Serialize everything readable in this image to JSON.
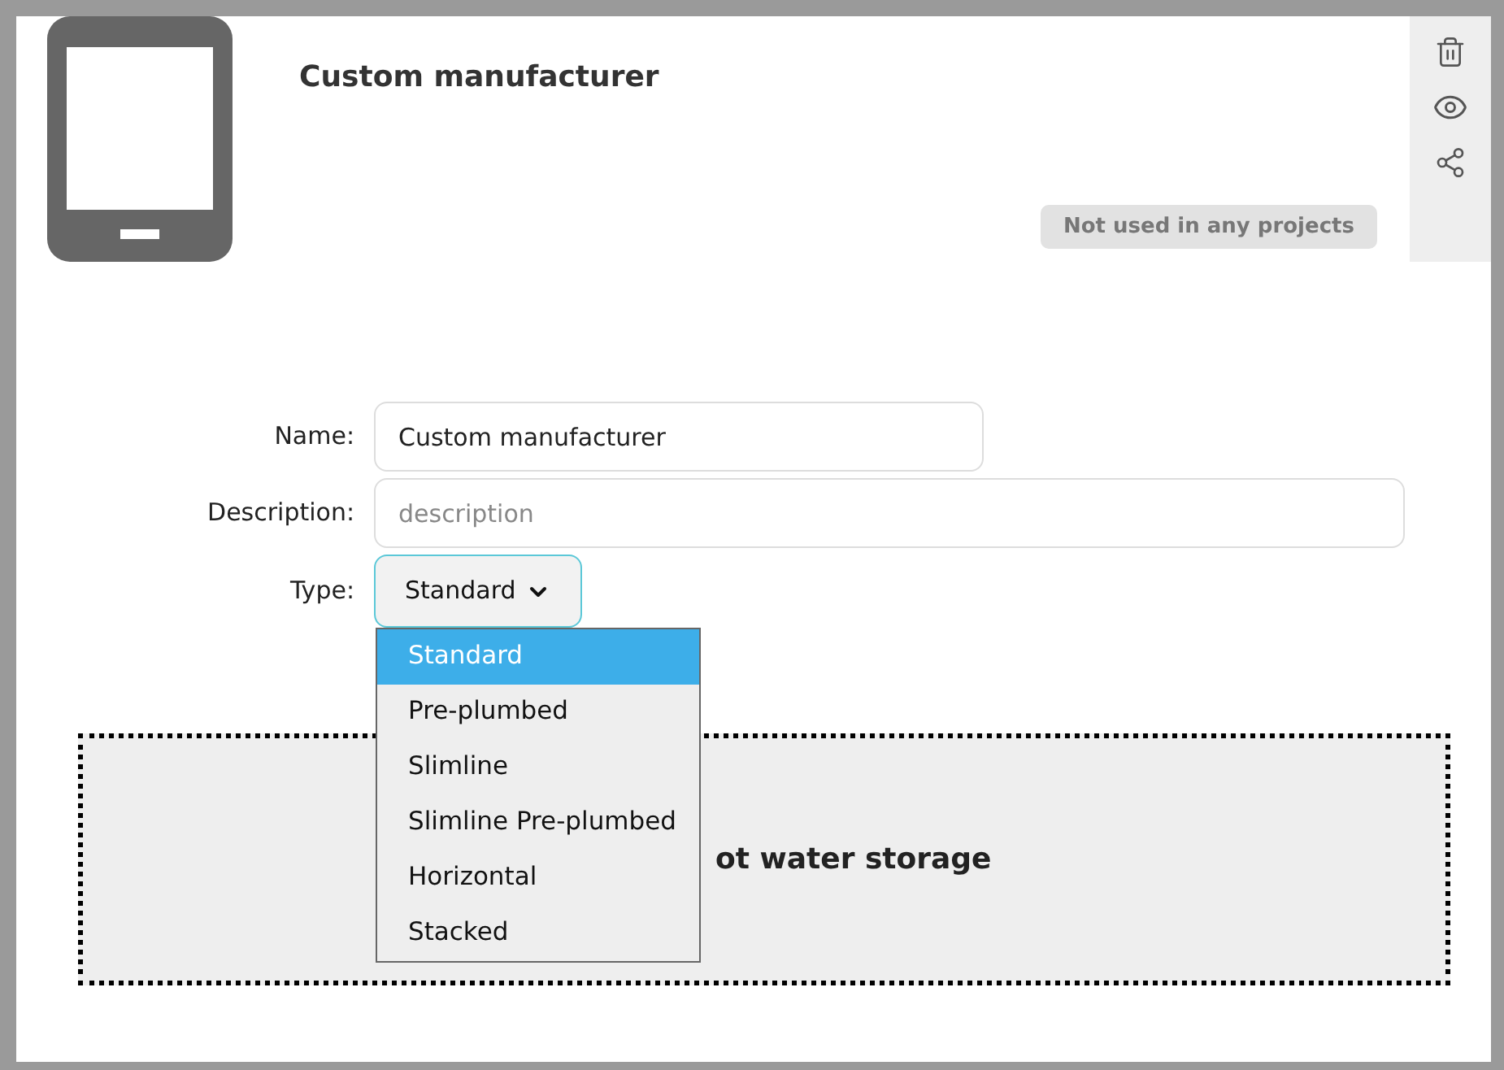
{
  "header": {
    "title": "Custom manufacturer",
    "usage_badge": "Not used in any projects"
  },
  "form": {
    "fields": [
      {
        "kind": "text",
        "label": "Name:",
        "value": "Custom manufacturer"
      },
      {
        "kind": "text",
        "label": "Description:",
        "placeholder": "description"
      },
      {
        "kind": "select",
        "label": "Type:",
        "value": "Standard",
        "expanded": true
      }
    ]
  },
  "type_options": [
    {
      "label": "Standard",
      "selected": true
    },
    {
      "label": "Pre-plumbed",
      "selected": false
    },
    {
      "label": "Slimline",
      "selected": false
    },
    {
      "label": "Slimline Pre-plumbed",
      "selected": false
    },
    {
      "label": "Horizontal",
      "selected": false
    },
    {
      "label": "Stacked",
      "selected": false
    }
  ],
  "drop_zone": {
    "text": "ot water storage"
  }
}
